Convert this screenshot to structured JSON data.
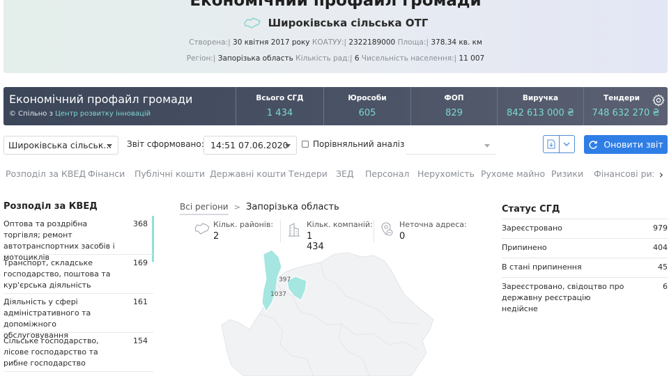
{
  "header": {
    "title": "Економічний профайл громади",
    "community_name": "Широківська сільська ОТГ",
    "meta1": [
      {
        "label": "Створена:",
        "value": "30 квітня 2017 року"
      },
      {
        "label": "КОАТУУ:",
        "value": "2322189000"
      },
      {
        "label": "Площа:",
        "value": "378.34 кв. км"
      }
    ],
    "meta2": [
      {
        "label": "Регіон:",
        "value": "Запорізька область"
      },
      {
        "label": "Кількість рад:",
        "value": "6"
      },
      {
        "label": "Чисельність населення:",
        "value": "11 007"
      }
    ]
  },
  "banner": {
    "title": "Економічний профайл громади",
    "copyright_prefix": "© Спільно з",
    "copyright_link": "Центр розвитку інновацій",
    "stats": [
      {
        "label": "Всього СГД",
        "value": "1 434"
      },
      {
        "label": "Юрособи",
        "value": "605"
      },
      {
        "label": "ФОП",
        "value": "829"
      },
      {
        "label": "Виручка",
        "value": "842 613 000 ₴"
      },
      {
        "label": "Тендери",
        "value": "748 632 270 ₴"
      }
    ]
  },
  "toolbar": {
    "community_select": "Широківська сільськ...",
    "report_label": "Звіт сформовано:",
    "report_date": "14:51 07.06.2020",
    "compare_label": "Порівняльний аналіз",
    "refresh_label": "Оновити звіт"
  },
  "tabs": [
    "Розподіл за КВЕД",
    "Фінанси",
    "Публічні кошти",
    "Державні кошти",
    "Тендери",
    "ЗЕД",
    "Персонал",
    "Нерухомість",
    "Рухоме майно",
    "Ризики",
    "Фінансові ризи"
  ],
  "kved": {
    "title": "Розподіл за КВЕД",
    "items": [
      {
        "label": "Оптова та роздрібна торгівля; ремонт автотранспортних засобів і мотоциклів",
        "count": "368"
      },
      {
        "label": "Транспорт, складське господарство, поштова та кур'єрська діяльність",
        "count": "169"
      },
      {
        "label": "Діяльність у сфері адміністративного та допоміжного обслуговування",
        "count": "161"
      },
      {
        "label": "Сільське господарство, лісове господарство та рибне господарство",
        "count": "154"
      }
    ]
  },
  "region": {
    "breadcrumb_all": "Всі регіони",
    "breadcrumb_sep": ">",
    "breadcrumb_current": "Запорізька область",
    "kpis": [
      {
        "label": "Кільк. районів:",
        "value": "2"
      },
      {
        "label": "Кільк. компаній:",
        "value": "1 434"
      },
      {
        "label": "Неточна адреса:",
        "value": "0"
      }
    ],
    "map_labels": [
      "397",
      "1037"
    ]
  },
  "status": {
    "title": "Статус СГД",
    "items": [
      {
        "label": "Зареєстровано",
        "count": "979"
      },
      {
        "label": "Припинено",
        "count": "404"
      },
      {
        "label": "В стані припинення",
        "count": "45"
      },
      {
        "label": "Зареєстровано, свідоцтво про державну реєстрацію недійсне",
        "count": "6"
      }
    ]
  },
  "colors": {
    "accent": "#2f7ee6",
    "teal": "#7ad9d2",
    "banner": "#454e61"
  }
}
